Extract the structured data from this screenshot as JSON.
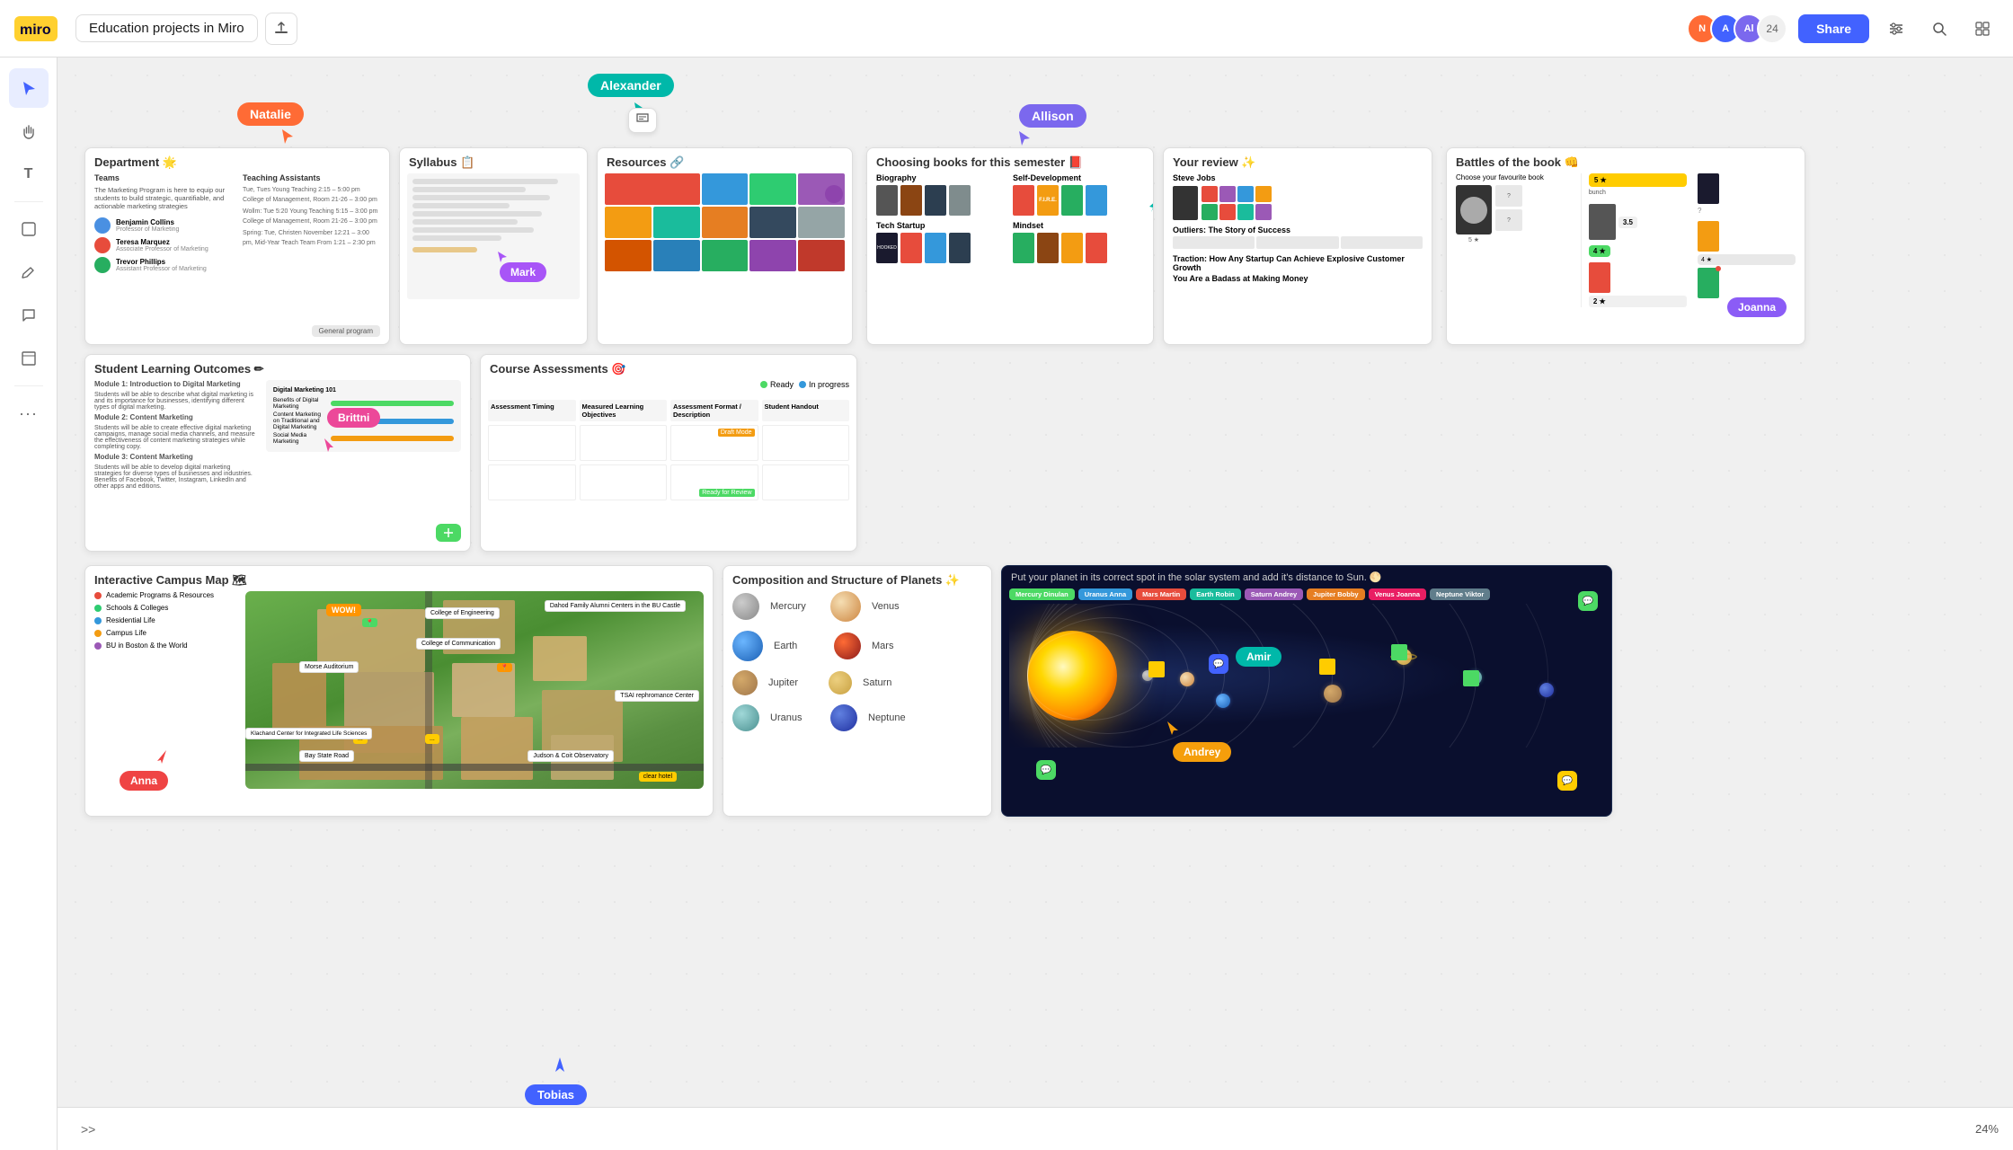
{
  "header": {
    "title": "Education projects in Miro",
    "share_label": "Share",
    "avatar_count": "24"
  },
  "sidebar": {
    "tools": [
      {
        "name": "select",
        "icon": "▲",
        "active": true
      },
      {
        "name": "hand",
        "icon": "✋",
        "active": false
      },
      {
        "name": "text",
        "icon": "T",
        "active": false
      },
      {
        "name": "note",
        "icon": "◻",
        "active": false
      },
      {
        "name": "pen",
        "icon": "╱",
        "active": false
      },
      {
        "name": "comment",
        "icon": "💬",
        "active": false
      },
      {
        "name": "frame",
        "icon": "⊞",
        "active": false
      },
      {
        "name": "more",
        "icon": "•••",
        "active": false
      }
    ]
  },
  "cursors": {
    "natalie": {
      "label": "Natalie",
      "color": "#ff6b35"
    },
    "alexander": {
      "label": "Alexander",
      "color": "#00b8a9"
    },
    "allison": {
      "label": "Allison",
      "color": "#7b68ee"
    },
    "mark": {
      "label": "Mark",
      "color": "#a855f7"
    },
    "brittni": {
      "label": "Brittni",
      "color": "#ec4899"
    },
    "anna": {
      "label": "Anna",
      "color": "#ef4444"
    },
    "amir": {
      "label": "Amir",
      "color": "#00b8a9"
    },
    "tobias": {
      "label": "Tobias",
      "color": "#4262ff"
    },
    "andrey": {
      "label": "Andrey",
      "color": "#f59e0b"
    },
    "joanna": {
      "label": "Joanna",
      "color": "#8b5cf6"
    }
  },
  "panels": {
    "department": {
      "title": "Department 🌟",
      "col1": "Teams",
      "col2": "Teaching Assistants"
    },
    "syllabus": {
      "title": "Syllabus 📋"
    },
    "resources": {
      "title": "Resources 🔗"
    },
    "books": {
      "title": "Choosing books for this semester 📕"
    },
    "review": {
      "title": "Your review ✨"
    },
    "battles": {
      "title": "Battles of the book 👊"
    },
    "outcomes": {
      "title": "Student Learning Outcomes ✏"
    },
    "assessments": {
      "title": "Course Assessments 🎯"
    },
    "campus": {
      "title": "Interactive Campus Map 🗺"
    },
    "composition": {
      "title": "Composition and Structure of Planets ✨"
    },
    "solar": {
      "title": "Put your planet in its correct spot in the solar system and add it's distance to Sun. 🌕"
    }
  },
  "planets": [
    {
      "name": "Mercury",
      "color": "#aaa",
      "size": 28
    },
    {
      "name": "Venus",
      "color": "#e8c98a",
      "size": 34
    },
    {
      "name": "Earth",
      "color": "#4a90e2",
      "size": 34
    },
    {
      "name": "Mars",
      "color": "#c0392b",
      "size": 30
    },
    {
      "name": "Jupiter",
      "color": "#c9a96e",
      "size": 26
    },
    {
      "name": "Saturn",
      "color": "#d4a017",
      "size": 24
    },
    {
      "name": "Uranus",
      "color": "#7ec8c8",
      "size": 28
    },
    {
      "name": "Neptune",
      "color": "#3b5fc0",
      "size": 28
    }
  ],
  "books_categories": [
    {
      "name": "Biography"
    },
    {
      "name": "Self-Development"
    },
    {
      "name": "Tech Startup"
    },
    {
      "name": "Mindset"
    }
  ],
  "bottom": {
    "zoom": "24%"
  },
  "solar_names": [
    "Mercury Dinulan",
    "Uranus Anna",
    "Mars Martin",
    "Earth Robin",
    "Saturn Andrey",
    "Jupiter Bobby",
    "Venus Joanna",
    "Neptune Viktor"
  ]
}
